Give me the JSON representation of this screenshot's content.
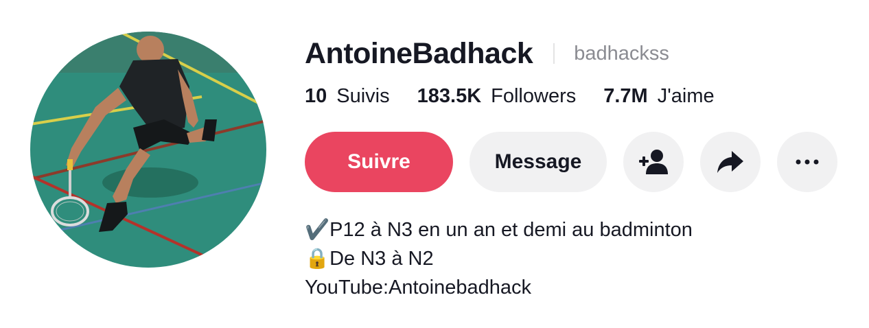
{
  "profile": {
    "display_name": "AntoineBadhack",
    "username": "badhackss"
  },
  "stats": [
    {
      "value": "10",
      "label": "Suivis"
    },
    {
      "value": "183.5K",
      "label": "Followers"
    },
    {
      "value": "7.7M",
      "label": "J'aime"
    }
  ],
  "actions": {
    "follow_label": "Suivre",
    "message_label": "Message",
    "add_friend_icon": "person-plus-icon",
    "share_icon": "share-arrow-icon",
    "more_icon": "more-dots-icon"
  },
  "bio": {
    "line1": "✔️P12 à N3 en un an et demi au badminton",
    "line2": "🔒De N3 à N2",
    "line3": "YouTube:Antoinebadhack"
  },
  "colors": {
    "follow": "#ea4560",
    "secondary_button": "#f1f1f2",
    "text": "#161823",
    "muted": "#8a8b91"
  }
}
